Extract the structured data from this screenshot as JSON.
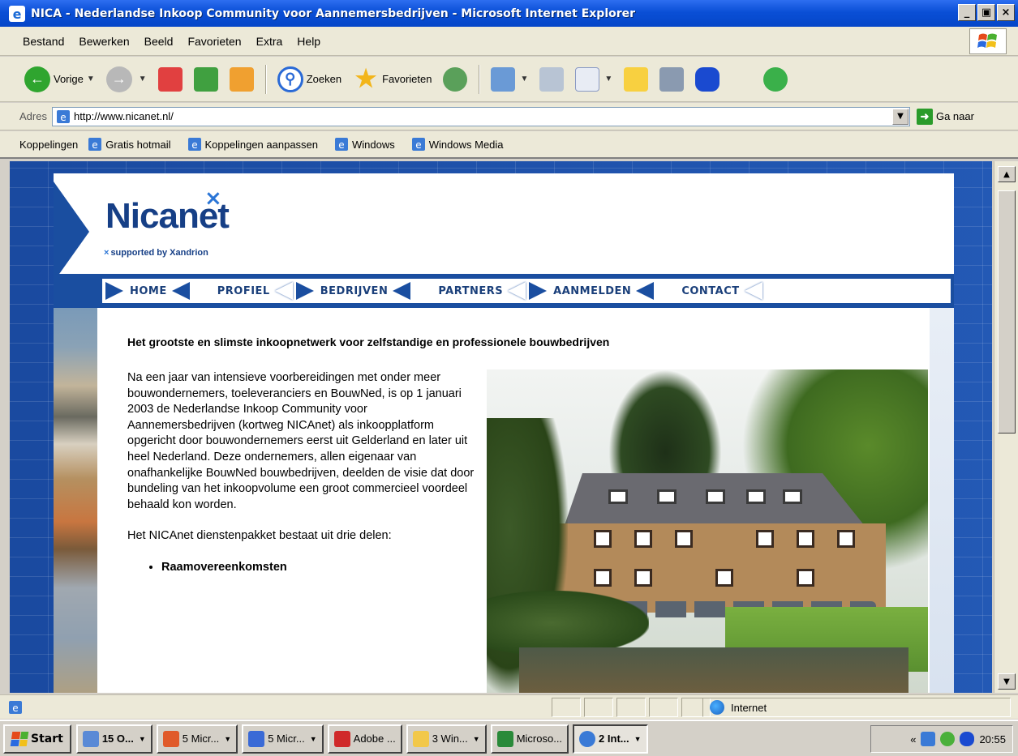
{
  "window": {
    "title": "NICA - Nederlandse Inkoop Community voor Aannemersbedrijven - Microsoft Internet Explorer",
    "minimize": "_",
    "maximize": "▣",
    "close": "×"
  },
  "menu": [
    "Bestand",
    "Bewerken",
    "Beeld",
    "Favorieten",
    "Extra",
    "Help"
  ],
  "toolbar": {
    "back_label": "Vorige",
    "search_label": "Zoeken",
    "favorites_label": "Favorieten"
  },
  "address": {
    "label": "Adres",
    "url": "http://www.nicanet.nl/",
    "go_label": "Ga naar"
  },
  "links": {
    "label": "Koppelingen",
    "items": [
      "Gratis hotmail",
      "Koppelingen aanpassen",
      "Windows",
      "Windows Media"
    ]
  },
  "site": {
    "logo": "Nicanet",
    "logo_mark": "×",
    "tagline_mark": "×",
    "tagline": "supported by Xandrion",
    "nav": [
      "HOME",
      "PROFIEL",
      "BEDRIJVEN",
      "PARTNERS",
      "AANMELDEN",
      "CONTACT"
    ],
    "headline": "Het grootste en slimste inkoopnetwerk voor zelfstandige en professionele bouwbedrijven",
    "paragraph1": "Na een jaar van intensieve voorbereidingen met onder meer bouwondernemers, toeleveranciers en BouwNed, is op 1 januari 2003 de Nederlandse Inkoop Community voor Aannemersbedrijven (kortweg NICAnet) als inkoopplatform opgericht door bouwondernemers eerst uit Gelderland en later uit heel Nederland. Deze ondernemers, allen eigenaar van onafhankelijke BouwNed bouwbedrijven, deelden de visie dat door bundeling van het inkoopvolume een groot commercieel voordeel behaald kon worden.",
    "paragraph2": "Het NICAnet dienstenpakket bestaat uit drie delen:",
    "bullet1": "Raamovereenkomsten"
  },
  "status": {
    "zone": "Internet"
  },
  "taskbar": {
    "start": "Start",
    "items": [
      "15 O...",
      "5 Micr...",
      "5 Micr...",
      "Adobe ...",
      "3 Win...",
      "Microso...",
      "2 Int..."
    ],
    "time": "20:55",
    "tray_chevron": "«"
  },
  "colors": {
    "brand_blue": "#1a4ea0",
    "title_bar": "#0a4fd6"
  }
}
